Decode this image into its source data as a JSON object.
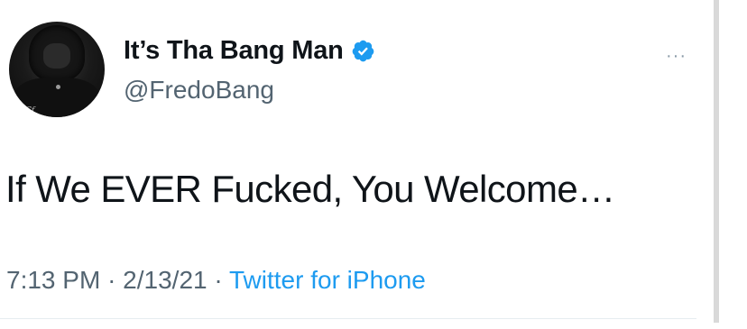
{
  "tweet": {
    "display_name": "It’s Tha Bang Man",
    "handle": "@FredoBang",
    "verified": true,
    "text": "If We EVER Fucked, You Welcome…",
    "time": "7:13 PM",
    "date": "2/13/21",
    "separator": "·",
    "source": "Twitter for iPhone",
    "more_icon": "···"
  },
  "icons": {
    "verified": "verified-badge-icon",
    "more": "more-options-icon"
  },
  "colors": {
    "verified_blue": "#1d9bf0",
    "link_blue": "#1d9bf0",
    "secondary_text": "#536471",
    "primary_text": "#0f1419"
  }
}
